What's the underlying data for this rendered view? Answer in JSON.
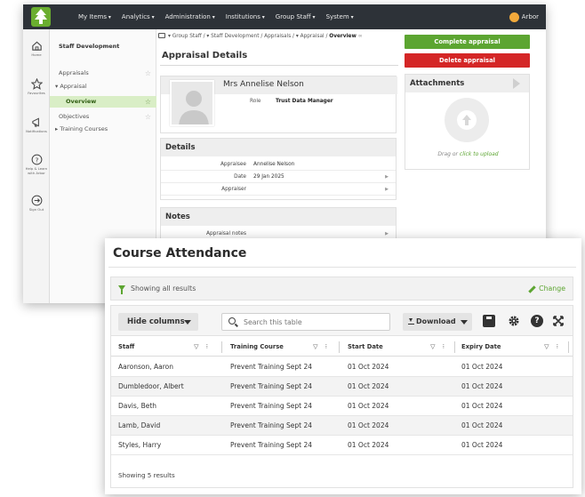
{
  "topbar": {
    "nav": [
      "My Items",
      "Analytics",
      "Administration",
      "Institutions",
      "Group Staff",
      "System"
    ],
    "brand": "Arbor"
  },
  "rail": [
    {
      "label": "Home",
      "icon": "home-icon"
    },
    {
      "label": "Favourites",
      "icon": "star-icon"
    },
    {
      "label": "Notifications",
      "icon": "megaphone-icon"
    },
    {
      "label": "Help & Learn with Arbor",
      "icon": "help-icon"
    },
    {
      "label": "Sign Out",
      "icon": "sign-out-icon"
    }
  ],
  "subnav": {
    "title": "Staff Development",
    "items": [
      {
        "label": "Appraisals"
      },
      {
        "label": "▾ Appraisal"
      },
      {
        "label": "Overview"
      },
      {
        "label": "Objectives"
      },
      {
        "label": "▸ Training Courses"
      }
    ]
  },
  "breadcrumb": {
    "trail": "▾ Group Staff  /  ▾ Staff Development  /  Appraisals  /  ▾ Appraisal  /",
    "current": "Overview"
  },
  "appraisal": {
    "page_title": "Appraisal Details",
    "profile": {
      "name": "Mrs Annelise Nelson",
      "role_label": "Role",
      "role_value": "Trust Data Manager"
    },
    "details_title": "Details",
    "details": [
      {
        "key": "Appraisee",
        "value": "Annelise Nelson"
      },
      {
        "key": "Date",
        "value": "29 Jan 2025"
      },
      {
        "key": "Appraiser",
        "value": ""
      }
    ],
    "notes_title": "Notes",
    "notes": [
      {
        "key": "Appraisal notes",
        "value": ""
      }
    ]
  },
  "actions": {
    "complete": "Complete appraisal",
    "delete": "Delete appraisal",
    "attachments_title": "Attachments",
    "upload_prefix": "Drag or ",
    "upload_link": "click to upload"
  },
  "course": {
    "title": "Course Attendance",
    "filter_text": "Showing all results",
    "change": "Change",
    "hide_columns": "Hide columns",
    "search_placeholder": "Search this table",
    "download": "Download",
    "columns": [
      "Staff",
      "Training Course",
      "Start Date",
      "Expiry Date"
    ],
    "rows": [
      [
        "Aaronson, Aaron",
        "Prevent Training Sept 24",
        "01 Oct 2024",
        "01 Oct 2024"
      ],
      [
        "Dumbledoor, Albert",
        "Prevent Training Sept 24",
        "01 Oct 2024",
        "01 Oct 2024"
      ],
      [
        "Davis, Beth",
        "Prevent Training Sept 24",
        "01 Oct 2024",
        "01 Oct 2024"
      ],
      [
        "Lamb, David",
        "Prevent Training Sept 24",
        "01 Oct 2024",
        "01 Oct 2024"
      ],
      [
        "Styles, Harry",
        "Prevent Training Sept 24",
        "01 Oct 2024",
        "01 Oct 2024"
      ]
    ],
    "footer": "Showing 5 results"
  },
  "colors": {
    "brand_green": "#5ca531",
    "danger_red": "#d42626",
    "topbar": "#2d3238"
  }
}
